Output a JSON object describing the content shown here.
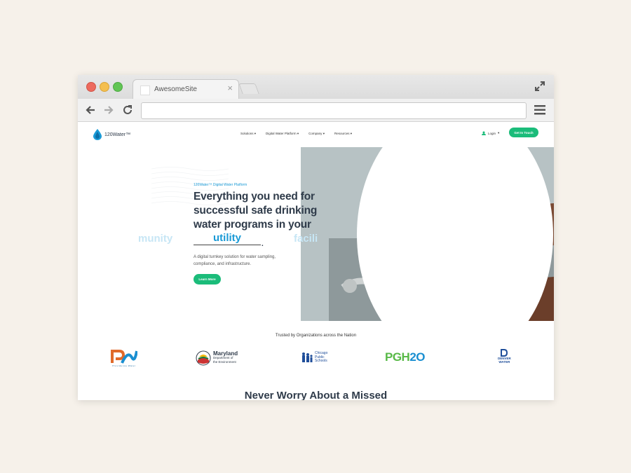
{
  "browser": {
    "tab_title": "AwesomeSite",
    "tab_close": "×",
    "url": ""
  },
  "site": {
    "logo_text": "120Water™",
    "nav": [
      {
        "label": "Solutions"
      },
      {
        "label": "Digital Water Platform"
      },
      {
        "label": "Company"
      },
      {
        "label": "Resources"
      }
    ],
    "nav_caret": "▾",
    "login": "Login",
    "get_in_touch": "Get In Touch",
    "hero": {
      "eyebrow": "120Water™ Digital Water Platform",
      "headline": "Everything you need for successful safe drinking water programs in your",
      "rotating_word": "utility",
      "rotating_suffix": ".",
      "ghost_left": "munity",
      "ghost_right": "facili",
      "subtext": "A digital turnkey solution for water sampling, compliance, and infrastructure.",
      "cta": "Learn More"
    },
    "trusted_heading": "Trusted by Organizations across the Nation",
    "orgs": {
      "providence": {
        "name": "Providence Water"
      },
      "maryland": {
        "line1": "Maryland",
        "line2": "Department of",
        "line3": "the Environment"
      },
      "chicago": {
        "line1": "Chicago",
        "line2": "Public",
        "line3": "Schools"
      },
      "pgh": {
        "prefix": "PGH",
        "suffix": "2O"
      },
      "denver": {
        "line1": "DENVER",
        "line2": "WATER"
      }
    },
    "next_section_heading": "Never Worry About a Missed"
  },
  "colors": {
    "accent_green": "#1bbc7a",
    "accent_blue": "#1a9ad6",
    "headline_navy": "#2f3b4a",
    "page_bg": "#f6f1ea"
  }
}
